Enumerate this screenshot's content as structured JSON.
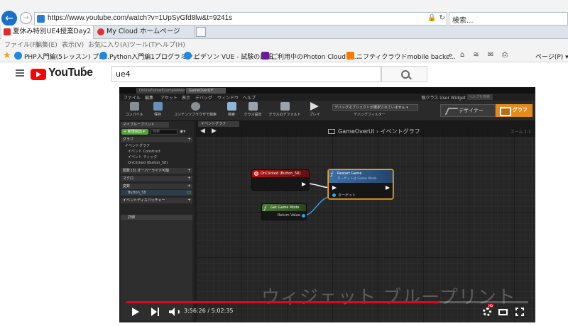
{
  "browser": {
    "url": "https://www.youtube.com/watch?v=1UpSyGfd8lw&t=9241s",
    "search_placeholder": "検索...",
    "tabs": [
      {
        "label": "夏休み特別UE4授業Day2 「..."
      },
      {
        "label": "My Cloud ホームページ"
      }
    ],
    "menu": [
      "ファイル(F)",
      "編集(E)",
      "表示(V)",
      "お気に入り(A)",
      "ツール(T)",
      "ヘルプ(H)"
    ],
    "favorites": [
      {
        "label": "PHP入門編(5レッスン) プロ..."
      },
      {
        "label": "Python入門編1プログラミン..."
      },
      {
        "label": "ビデソン VUE - 試験の詳細"
      },
      {
        "label": "ご利用中のPhoton Cloudア..."
      },
      {
        "label": "ニフティクラウドmobile backe..."
      }
    ],
    "page_menu": "ページ(P) ▾"
  },
  "youtube": {
    "logo_text": "YouTube",
    "region": "JP",
    "search_value": "ue4"
  },
  "ue4": {
    "window_tabs": [
      "OnlineFellowExampleMain*",
      "GameOverUI*"
    ],
    "menu": [
      "ファイル",
      "編集",
      "アセット",
      "表示",
      "デバッグ",
      "ウィンドウ",
      "ヘルプ"
    ],
    "parent_class": "親クラス User Widget",
    "help_search": "ヘルプを検索",
    "toolbar": [
      {
        "label": "コンパイル"
      },
      {
        "label": "保存"
      },
      {
        "label": "コンテンツブラウザで検索"
      },
      {
        "label": "検索"
      },
      {
        "label": "クラス設定"
      },
      {
        "label": "クラスのデフォルト"
      },
      {
        "label": "プレイ"
      }
    ],
    "debug_dropdown": "デバッグオブジェクトが選択されていません ▾",
    "debug_filter_label": "デバッグフィルター",
    "designer_label": "デザイナー",
    "graph_label": "グラフ",
    "my_blueprint": {
      "tab": "マイブループリント",
      "add_new": "+ 新規追加 ▾",
      "search": "検索",
      "rows": [
        {
          "label": "グラフ",
          "kind": "cat"
        },
        {
          "label": "イベントグラフ",
          "kind": "sub"
        },
        {
          "label": "イベント Construct",
          "kind": "leaf"
        },
        {
          "label": "イベント ティック",
          "kind": "leaf"
        },
        {
          "label": "OnClicked (Button_58)",
          "kind": "leaf"
        },
        {
          "label": "関数 (3) オーバーライド可能",
          "kind": "cat"
        },
        {
          "label": "マクロ",
          "kind": "cat"
        },
        {
          "label": "変数",
          "kind": "cat"
        },
        {
          "label": "Button_58",
          "kind": "var"
        },
        {
          "label": "イベントディスパッチャー",
          "kind": "cat"
        }
      ],
      "details_tab": "詳細"
    },
    "graph": {
      "tab": "イベントグラフ",
      "breadcrumb_root": "GameOverUI",
      "breadcrumb_sep": "›",
      "breadcrumb_leaf": "イベントグラフ",
      "zoom": "ズーム 1:1",
      "nodes": {
        "onclicked": {
          "title": "OnClicked (Button_58)"
        },
        "restart": {
          "title": "Restart Game",
          "subtitle": "ターゲットは Game Mode",
          "pin_target": "ターゲット"
        },
        "getgm": {
          "title": "Get Game Mode",
          "pin_return": "Return Value"
        }
      }
    },
    "watermark": "ウィジェット ブループリント"
  },
  "player": {
    "current_time": "3:56:26",
    "duration": "5:02:35",
    "progress": 0.78,
    "hd_badge": "HD"
  },
  "colors": {
    "youtube_red": "#ff0000",
    "progress_red": "#e0081a",
    "ue_graph_orange": "#e48a1a",
    "exec_node_red": "#b31212",
    "pure_node_green": "#4d7a36",
    "function_node_blue": "#3e6fa6",
    "selection_orange": "#f5a623"
  }
}
